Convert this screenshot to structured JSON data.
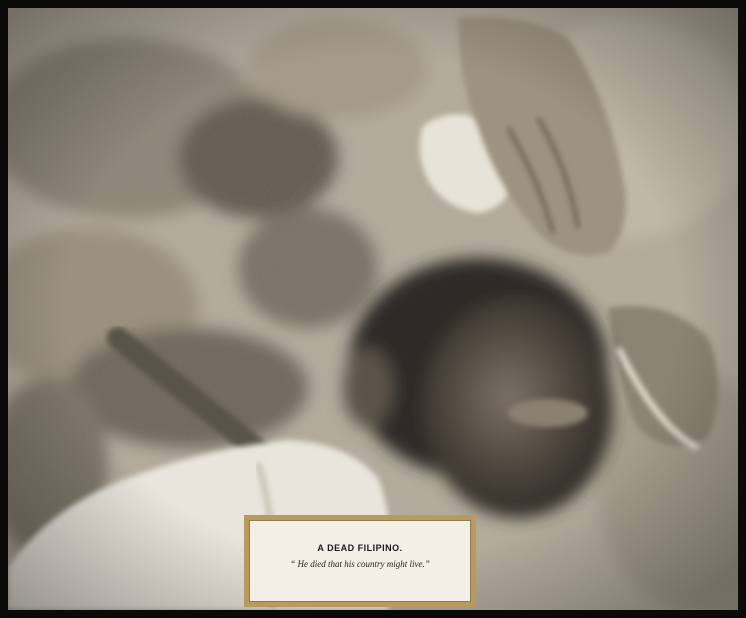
{
  "photo": {
    "description_icon": "sepia-photograph",
    "tone_colors": {
      "paper": "#cdc4b3",
      "shadow": "#3b3631",
      "highlight": "#efece4"
    }
  },
  "caption": {
    "title": "A DEAD FILIPINO.",
    "quote": "“ He died that his country might live.”"
  }
}
